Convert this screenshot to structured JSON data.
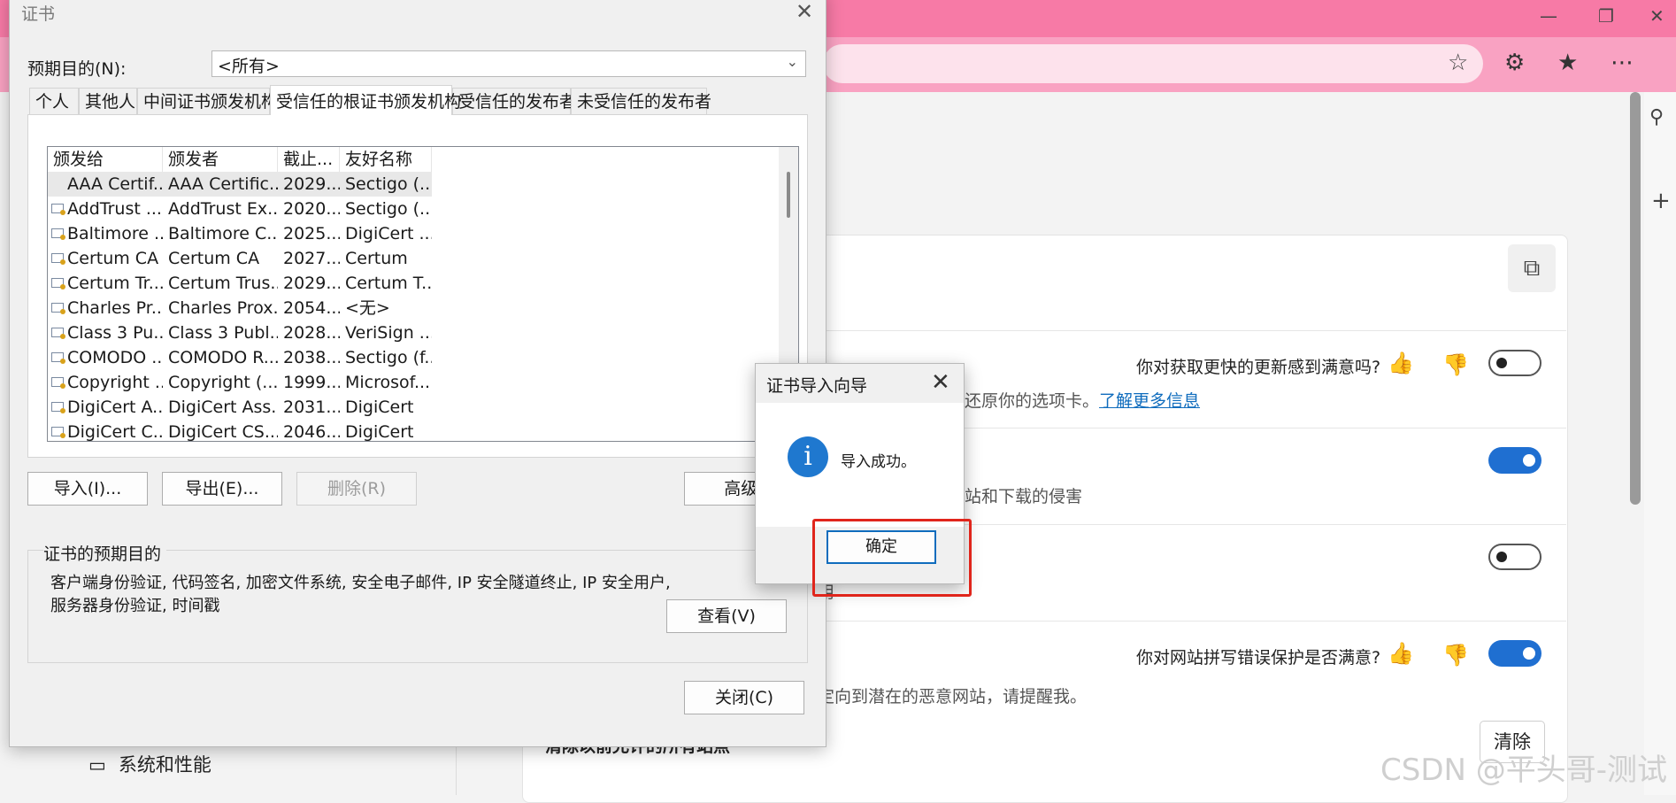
{
  "browser": {
    "feedback": [
      {
        "question": "你对获取更快的更新感到满意吗?"
      },
      {
        "question": "你对网站拼写错误保护是否满意?"
      }
    ],
    "rows": {
      "r1_desc_suffix": "还原你的选项卡。",
      "r1_link": "了解更多信息",
      "r2_desc_suffix": "站和下载的侵害",
      "r3_desc_suffix": "用",
      "r4_desc_suffix": "定向到潜在的恶意网站，请提醒我。",
      "r5_title_partial": "清除以前允许的所有站点"
    },
    "clear_button": "清除",
    "nav_item": "系统和性能",
    "watermark": "CSDN @平头哥-测试",
    "toggles": {
      "r1": "off",
      "r2": "on",
      "r3": "off",
      "r4": "on"
    }
  },
  "cert_dialog": {
    "title": "证书",
    "purpose_label": "预期目的(N):",
    "purpose_value": "<所有>",
    "tabs": [
      "个人",
      "其他人",
      "中间证书颁发机构",
      "受信任的根证书颁发机构",
      "受信任的发布者",
      "未受信任的发布者"
    ],
    "active_tab": "受信任的根证书颁发机构",
    "columns": [
      "颁发给",
      "颁发者",
      "截止...",
      "友好名称"
    ],
    "rows": [
      [
        "AAA Certif...",
        "AAA Certific...",
        "2029...",
        "Sectigo (..."
      ],
      [
        "AddTrust ...",
        "AddTrust Ex...",
        "2020...",
        "Sectigo (..."
      ],
      [
        "Baltimore ...",
        "Baltimore C...",
        "2025...",
        "DigiCert ..."
      ],
      [
        "Certum CA",
        "Certum CA",
        "2027...",
        "Certum"
      ],
      [
        "Certum Tr...",
        "Certum Trus...",
        "2029...",
        "Certum T..."
      ],
      [
        "Charles Pr...",
        "Charles Prox...",
        "2054...",
        "<无>"
      ],
      [
        "Class 3 Pu...",
        "Class 3 Publ...",
        "2028...",
        "VeriSign ..."
      ],
      [
        "COMODO ...",
        "COMODO R...",
        "2038...",
        "Sectigo (f..."
      ],
      [
        "Copyright ...",
        "Copyright (...",
        "1999...",
        "Microsof..."
      ],
      [
        "DigiCert A...",
        "DigiCert Ass...",
        "2031...",
        "DigiCert"
      ],
      [
        "DigiCert C...",
        "DigiCert CS...",
        "2046...",
        "DigiCert"
      ]
    ],
    "buttons": {
      "import": "导入(I)...",
      "export": "导出(E)...",
      "remove": "删除(R)",
      "advanced": "高级(",
      "view": "查看(V)",
      "close": "关闭(C)"
    },
    "group_label": "证书的预期目的",
    "group_text": "客户端身份验证, 代码签名, 加密文件系统, 安全电子邮件, IP 安全隧道终止, IP 安全用户, 服务器身份验证, 时间戳"
  },
  "wizard": {
    "title": "证书导入向导",
    "message": "导入成功。",
    "ok": "确定"
  },
  "colors": {
    "browser_accent": "#f77aa6",
    "toggle_on": "#1f6fd1",
    "highlight": "#e0251b",
    "info_icon": "#1f78cf"
  }
}
